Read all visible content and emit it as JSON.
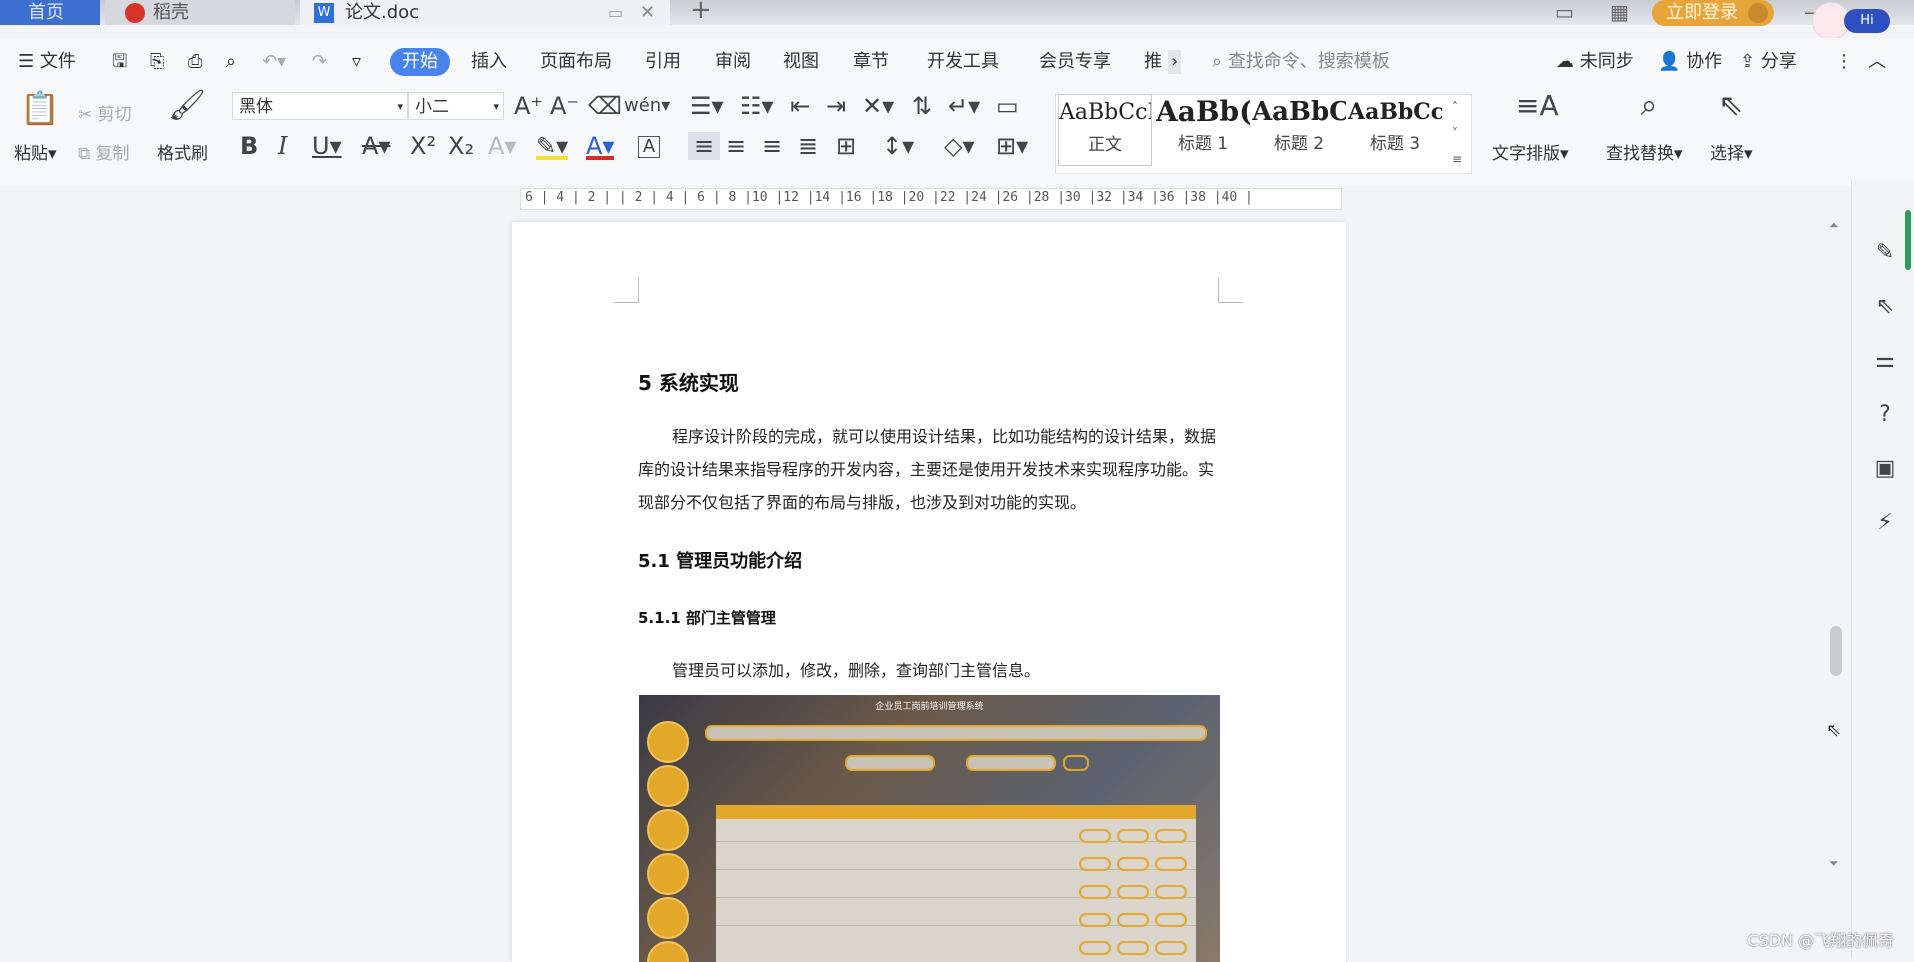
{
  "titlebar": {
    "tabs": [
      {
        "label": "首页"
      },
      {
        "label": "稻壳"
      },
      {
        "label": "论文.doc"
      }
    ],
    "new_tab_symbol": "+",
    "login_label": "立即登录",
    "assistant_badge": "Hi"
  },
  "menubar": {
    "file_label": "文件",
    "items": [
      "开始",
      "插入",
      "页面布局",
      "引用",
      "审阅",
      "视图",
      "章节",
      "开发工具",
      "会员专享",
      "推"
    ],
    "search_placeholder": "查找命令、搜索模板",
    "sync_label": "未同步",
    "collab_label": "协作",
    "share_label": "分享"
  },
  "ribbon": {
    "paste_label": "粘贴",
    "cut_label": "剪切",
    "copy_label": "复制",
    "format_painter_label": "格式刷",
    "font_name": "黑体",
    "font_size": "小二",
    "pinyin_label": "wén",
    "styles": [
      {
        "sample": "AaBbCcI",
        "name": "正文"
      },
      {
        "sample": "AaBb(",
        "name": "标题 1"
      },
      {
        "sample": "AaBbC",
        "name": "标题 2"
      },
      {
        "sample": "AaBbCcl",
        "name": "标题 3"
      }
    ],
    "text_layout_label": "文字排版",
    "find_replace_label": "查找替换",
    "select_label": "选择"
  },
  "ruler": {
    "numbers": "6 | 4 | 2 |   | 2 | 4 | 6 | 8 |10 |12 |14 |16 |18 |20 |22 |24 |26 |28 |30 |32 |34 |36 |38 |40 |"
  },
  "document": {
    "heading1": "5  系统实现",
    "paragraph1": "程序设计阶段的完成，就可以使用设计结果，比如功能结构的设计结果，数据库的设计结果来指导程序的开发内容，主要还是使用开发技术来实现程序功能。实现部分不仅包括了界面的布局与排版，也涉及到对功能的实现。",
    "heading2": "5.1 管理员功能介绍",
    "heading3": "5.1.1 部门主管管理",
    "paragraph2": "管理员可以添加，修改，删除，查询部门主管信息。",
    "embedded_screenshot_title": "企业员工岗前培训管理系统"
  },
  "watermark": "CSDN @飞翔的佩奇",
  "icons": {
    "right_panel": [
      "pen-icon",
      "cursor-icon",
      "sliders-icon",
      "help-icon",
      "image-tool-icon",
      "lightning-icon"
    ]
  },
  "colors": {
    "accent_blue": "#4a83ee",
    "login_orange": "#e7a43a",
    "screenshot_gold": "#e3a72a"
  }
}
